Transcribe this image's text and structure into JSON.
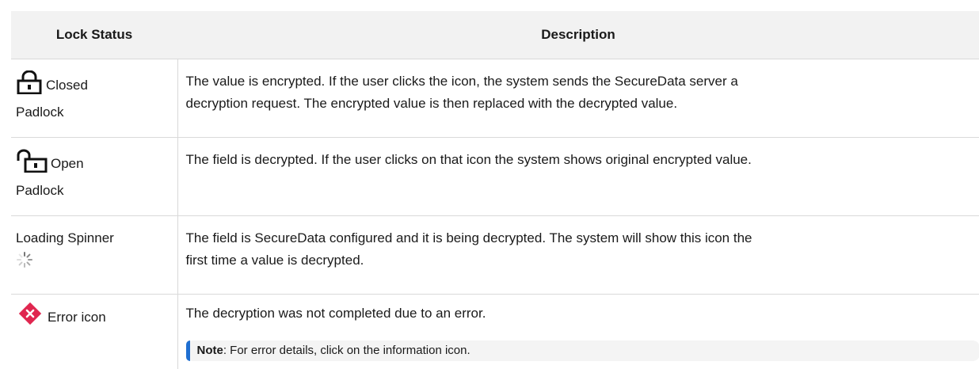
{
  "header": {
    "col1": "Lock Status",
    "col2": "Description"
  },
  "rows": [
    {
      "icon": "closed-padlock-icon",
      "status_a": "Closed",
      "status_b": "Padlock",
      "desc_1": "The value is encrypted. If the user clicks the icon, the system sends the SecureData server a",
      "desc_2": "decryption request. The encrypted value is then replaced with the decrypted value."
    },
    {
      "icon": "open-padlock-icon",
      "status_a": "Open",
      "status_b": "Padlock",
      "desc_1": "The field is decrypted. If the user clicks on that icon the system shows original encrypted value."
    },
    {
      "icon": "loading-spinner-icon",
      "status_a": "Loading Spinner",
      "desc_1": "The field is SecureData configured and it is being decrypted. The system will show this icon the",
      "desc_2": "first time a value is decrypted."
    },
    {
      "icon": "error-icon",
      "status_a": "Error icon",
      "desc_1": "The decryption was not completed due to an error.",
      "note_label": "Note",
      "note_text": ": For error details, click on the information icon."
    }
  ],
  "colors": {
    "header_bg": "#f2f2f2",
    "border": "#d9d9d9",
    "error": "#e0264f",
    "note_accent": "#1f6fd1"
  }
}
